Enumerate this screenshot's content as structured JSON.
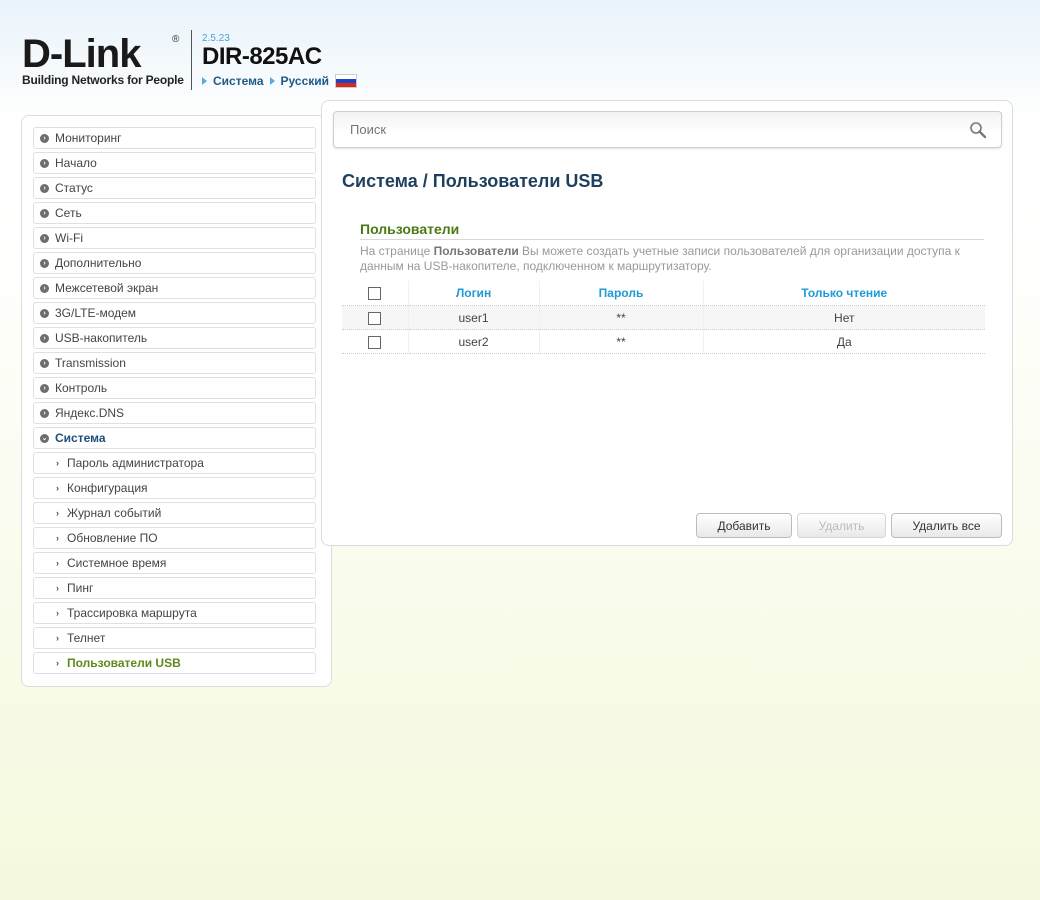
{
  "header": {
    "logo_text": "D-Link",
    "logo_registered": "®",
    "logo_tagline": "Building Networks for People",
    "version": "2.5.23",
    "model": "DIR-825AC",
    "crumb_system": "Система",
    "crumb_language": "Русский"
  },
  "sidebar": {
    "items": [
      {
        "label": "Мониторинг"
      },
      {
        "label": "Начало"
      },
      {
        "label": "Статус"
      },
      {
        "label": "Сеть"
      },
      {
        "label": "Wi-Fi"
      },
      {
        "label": "Дополнительно"
      },
      {
        "label": "Межсетевой экран"
      },
      {
        "label": "3G/LTE-модем"
      },
      {
        "label": "USB-накопитель"
      },
      {
        "label": "Transmission"
      },
      {
        "label": "Контроль"
      },
      {
        "label": "Яндекс.DNS"
      },
      {
        "label": "Система"
      }
    ],
    "subitems": [
      {
        "label": "Пароль администратора"
      },
      {
        "label": "Конфигурация"
      },
      {
        "label": "Журнал событий"
      },
      {
        "label": "Обновление ПО"
      },
      {
        "label": "Системное время"
      },
      {
        "label": "Пинг"
      },
      {
        "label": "Трассировка маршрута"
      },
      {
        "label": "Телнет"
      },
      {
        "label": "Пользователи USB"
      }
    ]
  },
  "search": {
    "placeholder": "Поиск"
  },
  "main": {
    "title": "Система /  Пользователи USB",
    "section_title": "Пользователи",
    "desc_prefix": "На странице ",
    "desc_bold": "Пользователи",
    "desc_suffix": " Вы можете создать учетные записи пользователей для организации доступа к данным на USB-накопителе, подключенном к маршрутизатору.",
    "columns": [
      "Логин",
      "Пароль",
      "Только чтение"
    ],
    "rows": [
      {
        "login": "user1",
        "password": "**",
        "readonly": "Нет"
      },
      {
        "login": "user2",
        "password": "**",
        "readonly": "Да"
      }
    ]
  },
  "buttons": {
    "add": "Добавить",
    "delete": "Удалить",
    "delete_all": "Удалить все"
  },
  "colors": {
    "accent": "#1e9ad6",
    "section_green": "#4a7a12",
    "current_green": "#5d8a1a",
    "title_blue": "#1f3f5f"
  }
}
